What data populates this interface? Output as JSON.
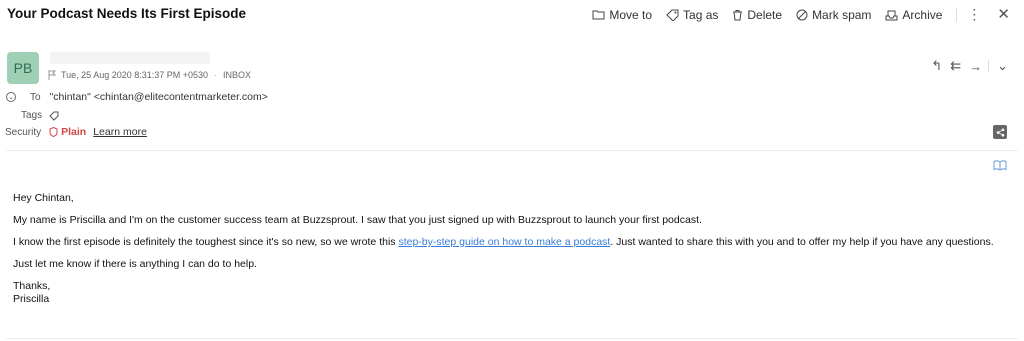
{
  "email": {
    "subject": "Your Podcast Needs Its First Episode",
    "avatar_initials": "PB",
    "date": "Tue, 25 Aug 2020 8:31:37 PM +0530",
    "folder": "INBOX",
    "to_label": "To",
    "to_value": "\"chintan\" <chintan@elitecontentmarketer.com>",
    "tags_label": "Tags",
    "security_label": "Security",
    "security_value": "Plain",
    "learn_more": "Learn more"
  },
  "toolbar": {
    "move_to": "Move to",
    "tag_as": "Tag as",
    "delete": "Delete",
    "mark_spam": "Mark spam",
    "archive": "Archive",
    "more": "⋮",
    "close": "✕"
  },
  "reply": {
    "reply": "↰",
    "reply_all": "⇇",
    "forward": "→",
    "dropdown": "⌄"
  },
  "body": {
    "greeting": "Hey Chintan,",
    "p1": "My name is Priscilla and I'm on the customer success team at Buzzsprout. I saw that you just signed up with Buzzsprout to launch your first podcast.",
    "p2_before": "I know the first episode is definitely the toughest since it's so new, so we wrote this ",
    "p2_link": "step-by-step guide on how to make a podcast",
    "p2_after": ". Just wanted to share this with you and to offer my help if you have any questions.",
    "p3": "Just let me know if there is anything I can do to help.",
    "closing": "Thanks,",
    "signature": "Priscilla"
  },
  "colors": {
    "avatar_bg": "#9fcfb4",
    "avatar_text": "#2e6f54",
    "plain_red": "#d64545",
    "link_blue": "#3a7bd5"
  }
}
